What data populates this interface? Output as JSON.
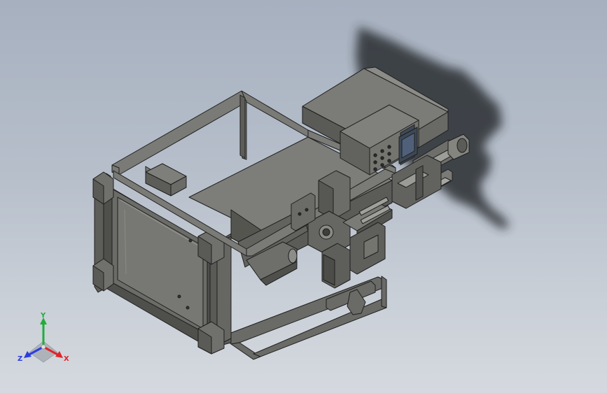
{
  "viewport": {
    "background_top": "#a6b0bf",
    "background_bottom": "#d5d9df",
    "model_color": "#6f706c",
    "model_edge_color": "#1f1f1f",
    "shadow_color": "#2c2f33"
  },
  "triad": {
    "x_label": "X",
    "y_label": "Y",
    "z_label": "Z",
    "x_color": "#e0242b",
    "y_color": "#1fae3a",
    "z_color": "#2c3de0"
  }
}
